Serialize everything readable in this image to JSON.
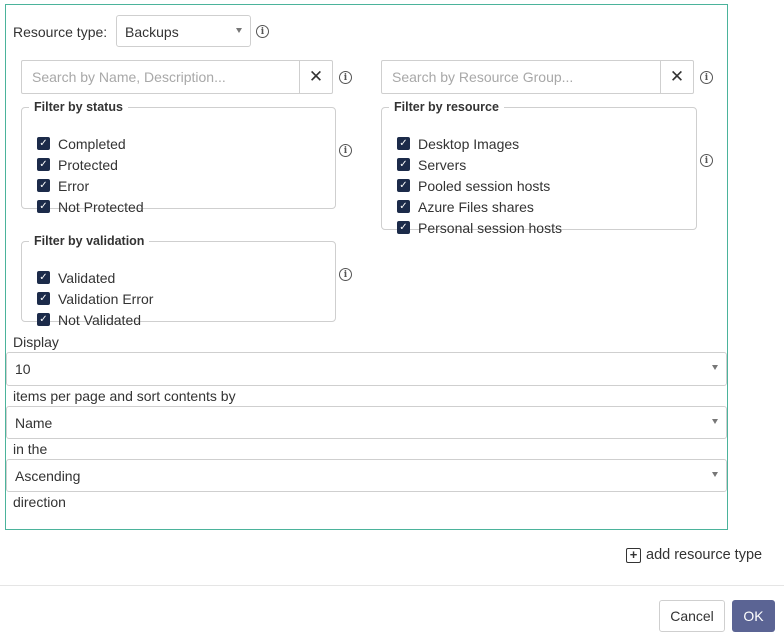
{
  "resource_type": {
    "label": "Resource type:",
    "value": "Backups"
  },
  "search_name": {
    "value": "",
    "placeholder": "Search by Name, Description..."
  },
  "search_group": {
    "value": "",
    "placeholder": "Search by Resource Group..."
  },
  "filter_status": {
    "legend": "Filter by status",
    "items": [
      {
        "label": "Completed",
        "checked": true
      },
      {
        "label": "Protected",
        "checked": true
      },
      {
        "label": "Error",
        "checked": true
      },
      {
        "label": "Not Protected",
        "checked": true
      }
    ]
  },
  "filter_resource": {
    "legend": "Filter by resource",
    "items": [
      {
        "label": "Desktop Images",
        "checked": true
      },
      {
        "label": "Servers",
        "checked": true
      },
      {
        "label": "Pooled session hosts",
        "checked": true
      },
      {
        "label": "Azure Files shares",
        "checked": true
      },
      {
        "label": "Personal session hosts",
        "checked": true
      }
    ]
  },
  "filter_validation": {
    "legend": "Filter by validation",
    "items": [
      {
        "label": "Validated",
        "checked": true
      },
      {
        "label": "Validation Error",
        "checked": true
      },
      {
        "label": "Not Validated",
        "checked": true
      }
    ]
  },
  "display": {
    "display_label": "Display",
    "per_page": "10",
    "items_label": "items per page and sort contents by",
    "sort_by": "Name",
    "in_the_label": "in the",
    "direction": "Ascending",
    "direction_label": "direction"
  },
  "icons": {
    "info": "info-icon",
    "clear": "close-icon",
    "checkbox": "checkmark-icon",
    "add": "plus-square-icon",
    "caret": "caret-down-icon"
  },
  "glyphs": {
    "info": "i",
    "clear": "✕",
    "check": "✓",
    "add": "+"
  },
  "add_resource_type": "add resource type",
  "buttons": {
    "cancel": "Cancel",
    "ok": "OK"
  },
  "colors": {
    "panel_border": "#4bb39b",
    "checkbox": "#1c2b4a",
    "ok_button": "#5b6494"
  }
}
